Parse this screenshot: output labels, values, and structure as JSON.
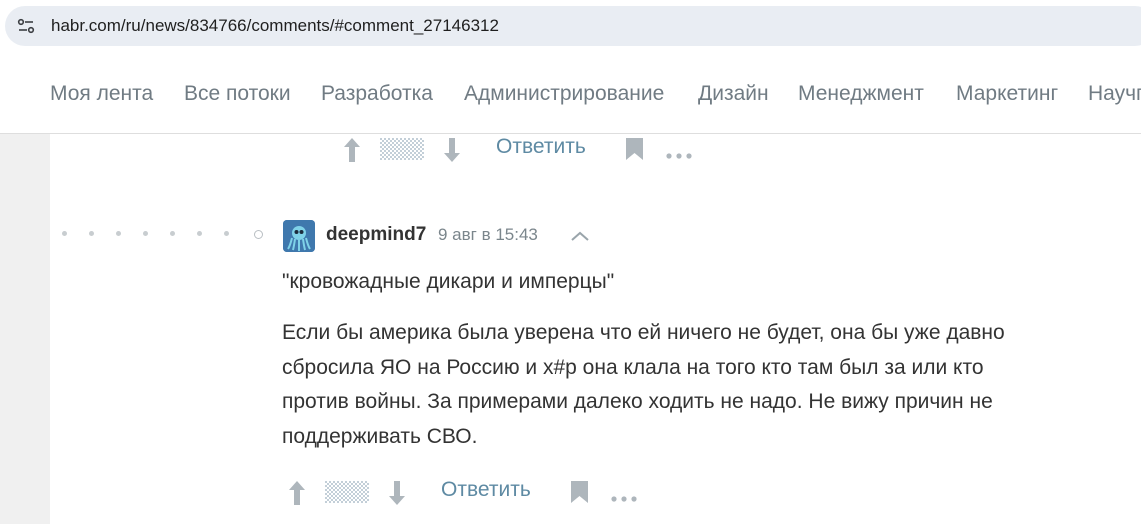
{
  "browser": {
    "url": "habr.com/ru/news/834766/comments/#comment_27146312",
    "site_info_icon": "tune-icon"
  },
  "nav": {
    "items": [
      {
        "label": "Моя лента"
      },
      {
        "label": "Все потоки"
      },
      {
        "label": "Разработка"
      },
      {
        "label": "Администрирование"
      },
      {
        "label": "Дизайн"
      },
      {
        "label": "Менеджмент"
      },
      {
        "label": "Маркетинг"
      },
      {
        "label": "Научпоп"
      }
    ],
    "color": "#707b83"
  },
  "prev_comment_actions": {
    "reply_label": "Ответить"
  },
  "comment": {
    "author": "deepmind7",
    "timestamp": "9 авг в 15:43",
    "quote": "\"кровожадные дикари и имперцы\"",
    "body_lines": [
      "Если бы америка была уверена что ей ничего не будет, она бы уже давно",
      "сбросила ЯО на Россию и х#р она клала на того кто там был за или кто",
      "против войны. За примерами далеко ходить не надо. Не вижу причин не",
      "поддерживать СВО."
    ],
    "reply_label": "Ответить"
  },
  "colors": {
    "link": "#5e8aa3",
    "icon_gray": "#aeb6bc",
    "background": "#f0f0f0",
    "card": "#ffffff"
  }
}
